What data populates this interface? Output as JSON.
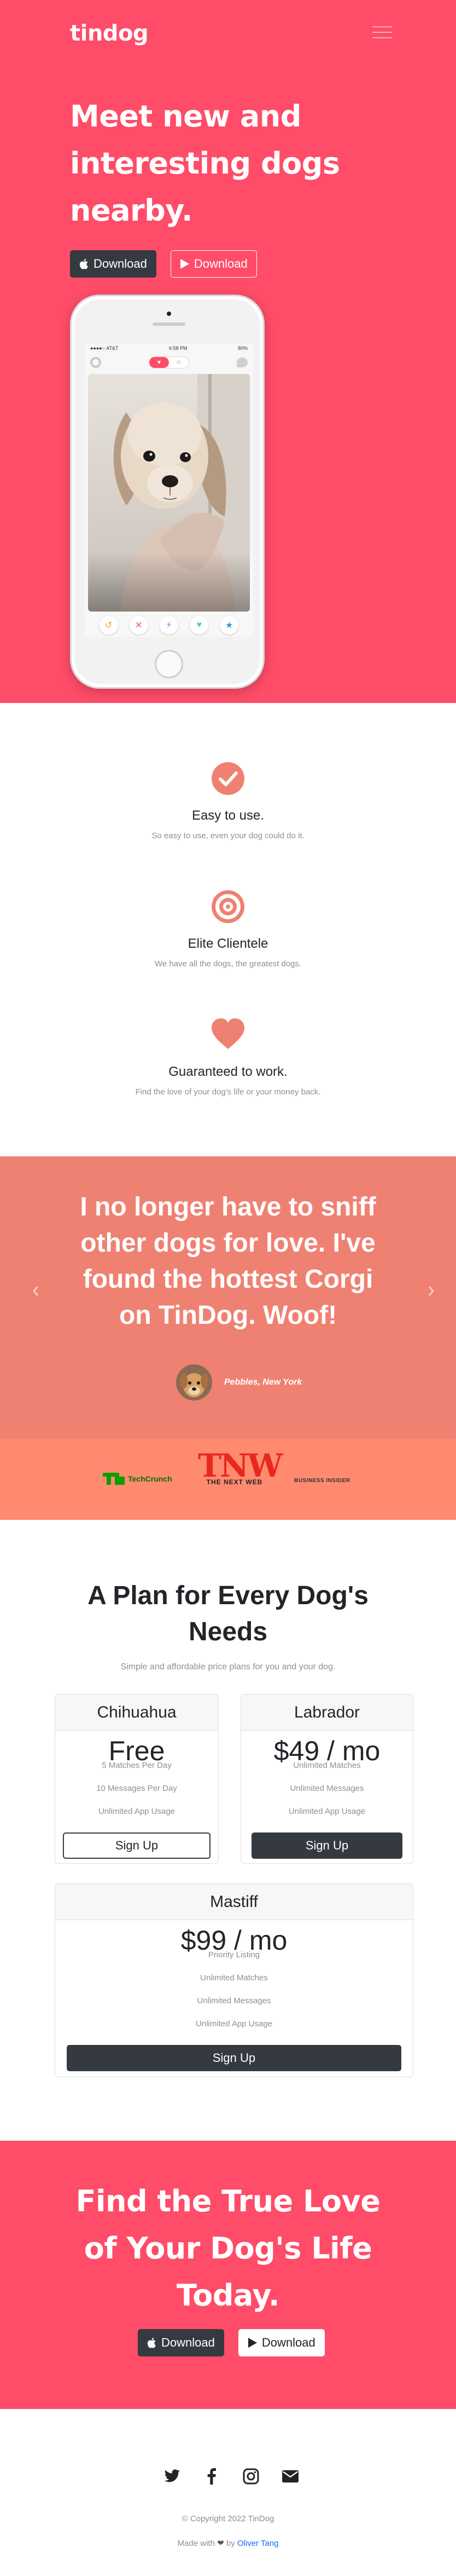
{
  "navbar": {
    "brand": "tindog"
  },
  "hero": {
    "title": "Meet new and interesting dogs nearby.",
    "btn_download_dark": "Download",
    "btn_download_outline": "Download",
    "phone_status_carrier": "●●●●○ AT&T",
    "phone_status_time": "6:58 PM",
    "phone_status_battery": "80%"
  },
  "features": [
    {
      "icon": "check-circle-icon",
      "title": "Easy to use.",
      "text": "So easy to use, even your dog could do it."
    },
    {
      "icon": "bullseye-icon",
      "title": "Elite Clientele",
      "text": "We have all the dogs, the greatest dogs."
    },
    {
      "icon": "heart-icon",
      "title": "Guaranteed to work.",
      "text": "Find the love of your dog's life or your money back."
    }
  ],
  "testimonial": {
    "quote": "I no longer have to sniff other dogs for love. I've found the hottest Corgi on TinDog. Woof!",
    "author": "Pebbles, New York"
  },
  "press": {
    "techcrunch": "TechCrunch",
    "tnw_top": "TNW",
    "tnw_bottom": "THE NEXT WEB",
    "business_insider": "BUSINESS INSIDER"
  },
  "pricing": {
    "title": "A Plan for Every Dog's Needs",
    "subtitle": "Simple and affordable price plans for you and your dog.",
    "plans": [
      {
        "name": "Chihuahua",
        "price": "Free",
        "features": [
          "5 Matches Per Day",
          "10 Messages Per Day",
          "Unlimited App Usage"
        ],
        "button": "Sign Up"
      },
      {
        "name": "Labrador",
        "price": "$49 / mo",
        "features": [
          "Unlimited Matches",
          "Unlimited Messages",
          "Unlimited App Usage"
        ],
        "button": "Sign Up"
      },
      {
        "name": "Mastiff",
        "price": "$99 / mo",
        "features": [
          "Priority Listing",
          "Unlimited Matches",
          "Unlimited Messages",
          "Unlimited App Usage"
        ],
        "button": "Sign Up"
      }
    ]
  },
  "cta": {
    "title": "Find the True Love of Your Dog's Life Today.",
    "btn_download_dark": "Download",
    "btn_download_white": "Download"
  },
  "footer": {
    "social": [
      "twitter-icon",
      "facebook-icon",
      "instagram-icon",
      "envelope-icon"
    ],
    "copyright": "© Copyright 2022 TinDog",
    "made_with_prefix": "Made with",
    "made_with_by": "by",
    "author_link": "Oliver Tang"
  },
  "colors": {
    "brand_red": "#ff4c68",
    "testimonial_bg": "#ef8172",
    "press_bg": "#ff8a6f",
    "dark": "#343a40",
    "link": "#0d6efd"
  }
}
